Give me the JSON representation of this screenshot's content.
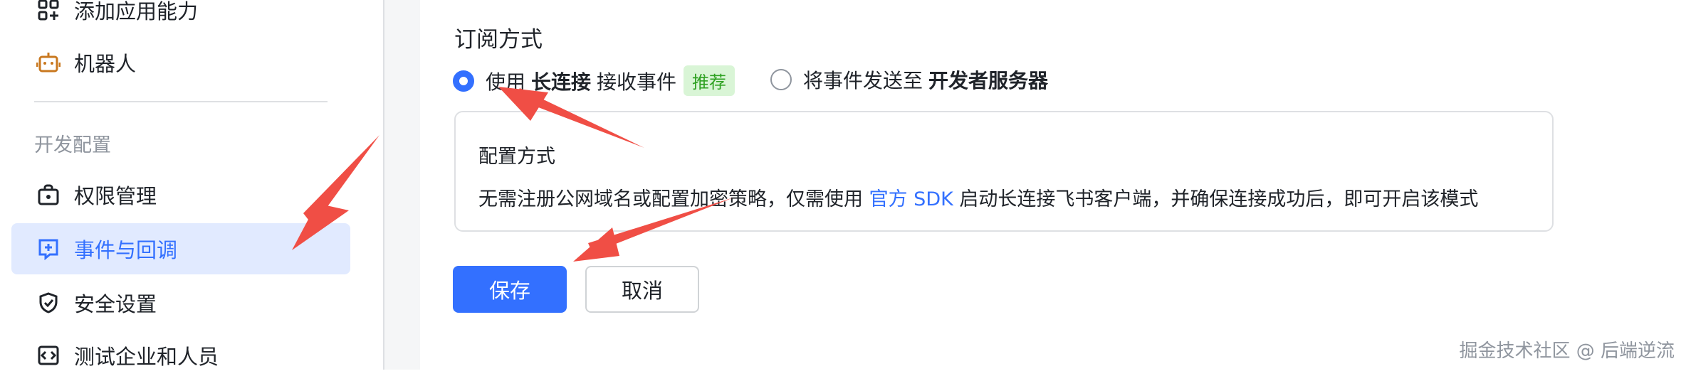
{
  "sidebar": {
    "items_top": [
      {
        "label": "添加应用能力",
        "icon": "add-apps-icon"
      },
      {
        "label": "机器人",
        "icon": "robot-icon"
      }
    ],
    "group_title": "开发配置",
    "items": [
      {
        "label": "权限管理",
        "icon": "permission-icon"
      },
      {
        "label": "事件与回调",
        "icon": "event-icon",
        "active": true
      },
      {
        "label": "安全设置",
        "icon": "shield-icon"
      },
      {
        "label": "测试企业和人员",
        "icon": "code-icon"
      }
    ]
  },
  "main": {
    "section_title": "订阅方式",
    "option1": {
      "prefix": "使用",
      "bold": "长连接",
      "suffix": "接收事件",
      "badge": "推荐",
      "checked": true
    },
    "option2": {
      "prefix": "将事件发送至",
      "bold": "开发者服务器",
      "checked": false
    },
    "card": {
      "title": "配置方式",
      "desc_prefix": "无需注册公网域名或配置加密策略，仅需使用",
      "desc_link": "官方 SDK",
      "desc_suffix": "启动长连接飞书客户端，并确保连接成功后，即可开启该模式"
    },
    "save_label": "保存",
    "cancel_label": "取消"
  },
  "watermark": "掘金技术社区 @ 后端逆流",
  "colors": {
    "accent": "#3370ff",
    "active_bg": "#e1eaff",
    "badge_bg": "#d9f5d6",
    "badge_text": "#2ea121",
    "arrow": "#f04e45"
  }
}
